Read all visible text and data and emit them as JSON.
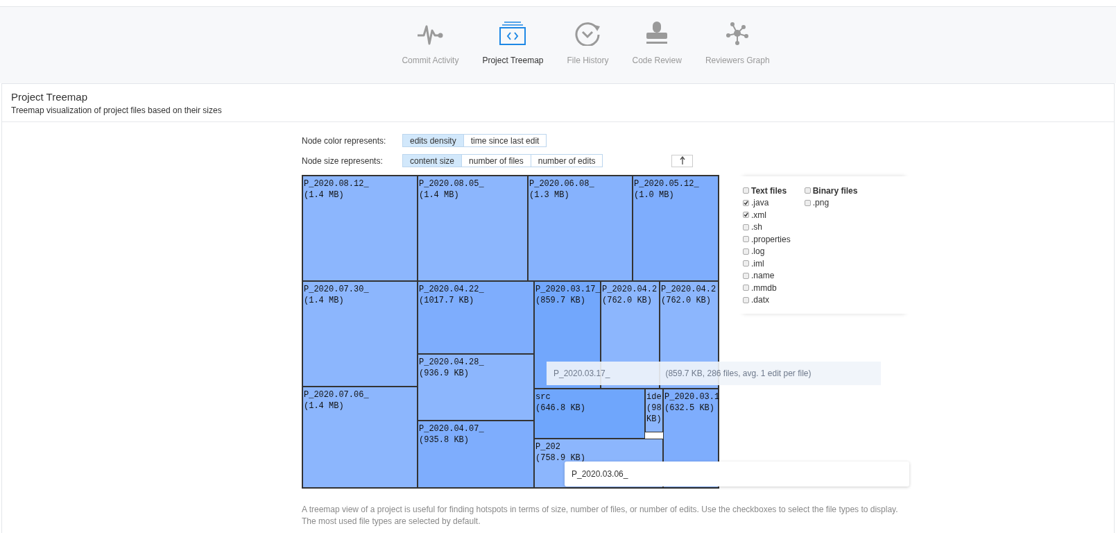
{
  "nav": [
    {
      "label": "Commit Activity",
      "kind": "pulse",
      "selected": false
    },
    {
      "label": "Project Treemap",
      "kind": "treemap",
      "selected": true
    },
    {
      "label": "File History",
      "kind": "history",
      "selected": false
    },
    {
      "label": "Code Review",
      "kind": "stamp",
      "selected": false
    },
    {
      "label": "Reviewers Graph",
      "kind": "graph",
      "selected": false
    }
  ],
  "panel": {
    "title": "Project Treemap",
    "subtitle": "Treemap visualization of project files based on their sizes"
  },
  "color_options": {
    "label": "Node color represents:",
    "options": [
      {
        "label": "edits density",
        "selected": true
      },
      {
        "label": "time since last edit",
        "selected": false
      }
    ]
  },
  "size_options": {
    "label": "Node size represents:",
    "options": [
      {
        "label": "content size",
        "selected": true
      },
      {
        "label": "number of files",
        "selected": false
      },
      {
        "label": "number of edits",
        "selected": false
      }
    ]
  },
  "treemap": {
    "nodes": [
      {
        "name": "P_2020.08.12_",
        "size": "(1.4 MB)",
        "color": "#8cb6fd"
      },
      {
        "name": "P_2020.08.05_",
        "size": "(1.4 MB)",
        "color": "#8cb6fd"
      },
      {
        "name": "P_2020.06.08_",
        "size": "(1.3 MB)",
        "color": "#86b2fd"
      },
      {
        "name": "P_2020.05.12_",
        "size": "(1.0 MB)",
        "color": "#7eadfd"
      },
      {
        "name": "P_2020.07.30_",
        "size": "(1.4 MB)",
        "color": "#8cb6fd"
      },
      {
        "name": "P_2020.07.06_",
        "size": "(1.4 MB)",
        "color": "#8cb6fd"
      },
      {
        "name": "P_2020.04.22_",
        "size": "(1017.7 KB)",
        "color": "#7eadfd"
      },
      {
        "name": "P_2020.04.28_",
        "size": "(936.9 KB)",
        "color": "#8cb6fd"
      },
      {
        "name": "P_2020.04.07_",
        "size": "(935.8 KB)",
        "color": "#7eadfd"
      },
      {
        "name": "P_2020.03.17_",
        "size": "(859.7 KB)",
        "color": "#72a7fc"
      },
      {
        "name": "P_2020.04.2",
        "size": "(762.0 KB)",
        "color": "#8cb6fd"
      },
      {
        "name": "P_2020.04.2",
        "size": "(762.0 KB)",
        "color": "#8cb6fd"
      },
      {
        "name": "src",
        "size": "(646.8 KB)",
        "color": "#6fa6fc"
      },
      {
        "name": "ide",
        "size": "(98 KB)",
        "color": "#8cb6fd"
      },
      {
        "name": "P_2020.03.1",
        "size": "(632.5 KB)",
        "color": "#7eadfd"
      },
      {
        "name": "P_202",
        "size": "(758.9 KB)",
        "color": "#8cb6fd"
      }
    ],
    "tooltips": [
      {
        "kind": "faded",
        "name": "P_2020.03.17_",
        "detail": "(859.7 KB, 286 files, avg. 1 edit per file)"
      },
      {
        "kind": "solid",
        "name": "P_2020.03.06_"
      }
    ]
  },
  "filters": [
    {
      "label": "Text files",
      "checked": false,
      "items": [
        {
          "label": ".java",
          "checked": true
        },
        {
          "label": ".xml",
          "checked": true
        },
        {
          "label": ".sh",
          "checked": false
        },
        {
          "label": ".properties",
          "checked": false
        },
        {
          "label": ".log",
          "checked": false
        },
        {
          "label": ".iml",
          "checked": false
        },
        {
          "label": ".name",
          "checked": false
        },
        {
          "label": ".mmdb",
          "checked": false
        },
        {
          "label": ".datx",
          "checked": false
        }
      ]
    },
    {
      "label": "Binary files",
      "checked": false,
      "items": [
        {
          "label": ".png",
          "checked": false
        }
      ]
    }
  ],
  "description": "A treemap view of a project is useful for finding hotspots in terms of size, number of files, or number of edits. Use the checkboxes to select the file types to display. The most used file types are selected by default."
}
